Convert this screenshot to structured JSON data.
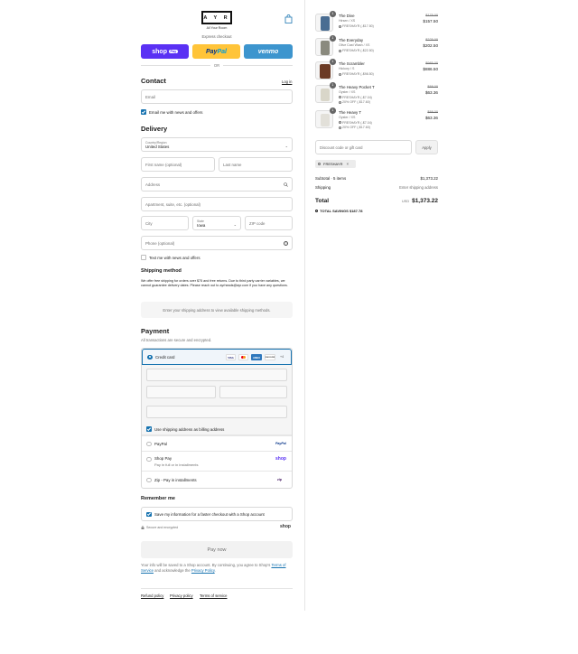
{
  "header": {
    "logo": "A Y R",
    "logo_sub": "All Your Room",
    "bag_icon": "shopping-bag-icon"
  },
  "express": {
    "label": "Express checkout",
    "shoppay": "shop",
    "shoppay_pill": "Pay",
    "paypal_1": "Pay",
    "paypal_2": "Pal",
    "venmo": "venmo",
    "or": "OR"
  },
  "contact": {
    "title": "Contact",
    "login": "Log in",
    "email_placeholder": "Email",
    "news_label": "Email me with news and offers"
  },
  "delivery": {
    "title": "Delivery",
    "country_label": "Country/Region",
    "country_value": "United States",
    "first_name": "First name (optional)",
    "last_name": "Last name",
    "address": "Address",
    "apartment": "Apartment, suite, etc. (optional)",
    "city": "City",
    "state_label": "State",
    "state_value": "Iowa",
    "zip": "ZIP code",
    "phone": "Phone (optional)",
    "text_label": "Text me with news and offers"
  },
  "shipping": {
    "title": "Shipping method",
    "note": "We offer free shipping for orders over $75 and free returns. Due to third party carrier variables, we cannot guarantee delivery dates. Please reach out to ayrheads@ayr.com if you have any questions.",
    "empty": "Enter your shipping address to view available shipping methods."
  },
  "payment": {
    "title": "Payment",
    "subtitle": "All transactions are secure and encrypted.",
    "credit_card": "Credit card",
    "brands": [
      "VISA",
      "MC",
      "AMEX",
      "DISCOVER"
    ],
    "more": "+4",
    "billing_label": "Use shipping address as billing address",
    "paypal": "PayPal",
    "paypal_logo": "PayPal",
    "shop_pay": "Shop Pay",
    "shop_pay_sub": "Pay in full or in installments",
    "shop_pay_logo": "shop",
    "zip": "Zip - Pay in installments",
    "zip_logo": "zip"
  },
  "remember": {
    "title": "Remember me",
    "save_label": "Save my information for a faster checkout with a Shop account",
    "secure": "Secure and encrypted",
    "shop_logo": "shop"
  },
  "paynow": "Pay now",
  "legal": {
    "pre": "Your info will be saved to a Shop account. By continuing, you agree to Shop's",
    "tos": "Terms of Service",
    "mid": "and acknowledge the",
    "privacy": "Privacy Policy",
    "end": "."
  },
  "footer": {
    "refund": "Refund policy",
    "privacy": "Privacy policy",
    "terms": "Terms of service"
  },
  "items": [
    {
      "name": "The Dive",
      "variant": "Hirsen / XS",
      "discount": "FRESHAYR (-$17.50)",
      "discount2": "",
      "old": "$175.00",
      "price": "$157.50",
      "qty": "1",
      "color": "#4a6d92"
    },
    {
      "name": "The Everyday",
      "variant": "Olive Cast Wash / XS",
      "discount": "FRESHAYR (-$22.50)",
      "discount2": "",
      "old": "$225.00",
      "price": "$202.50",
      "qty": "1",
      "color": "#8a8a7e"
    },
    {
      "name": "The Scrambler",
      "variant": "Hickory / S",
      "discount": "FRESHAYR (-$98.50)",
      "discount2": "",
      "old": "$985.00",
      "price": "$886.50",
      "qty": "1",
      "color": "#6b3a24"
    },
    {
      "name": "The Heavy Pocket T",
      "variant": "Oyster / XS",
      "discount": "FRESHAYR (-$7.04)",
      "discount2": "20% OFF (-$17.60)",
      "old": "$88.00",
      "price": "$63.36",
      "qty": "1",
      "color": "#e8e6dc"
    },
    {
      "name": "The Heavy T",
      "variant": "Oyster / XS",
      "discount": "FRESHAYR (-$7.04)",
      "discount2": "20% OFF (-$17.60)",
      "old": "$88.00",
      "price": "$63.36",
      "qty": "1",
      "color": "#ecebe6"
    }
  ],
  "summary": {
    "discount_placeholder": "Discount code or gift card",
    "apply": "Apply",
    "code": "FRESHAYR",
    "subtotal_label": "Subtotal · 5 items",
    "subtotal": "$1,373.22",
    "shipping_label": "Shipping",
    "shipping_value": "Enter shipping address",
    "total_label": "Total",
    "currency": "USD",
    "total": "$1,373.22",
    "savings_label": "TOTAL SAVINGS",
    "savings": "$187.78"
  }
}
